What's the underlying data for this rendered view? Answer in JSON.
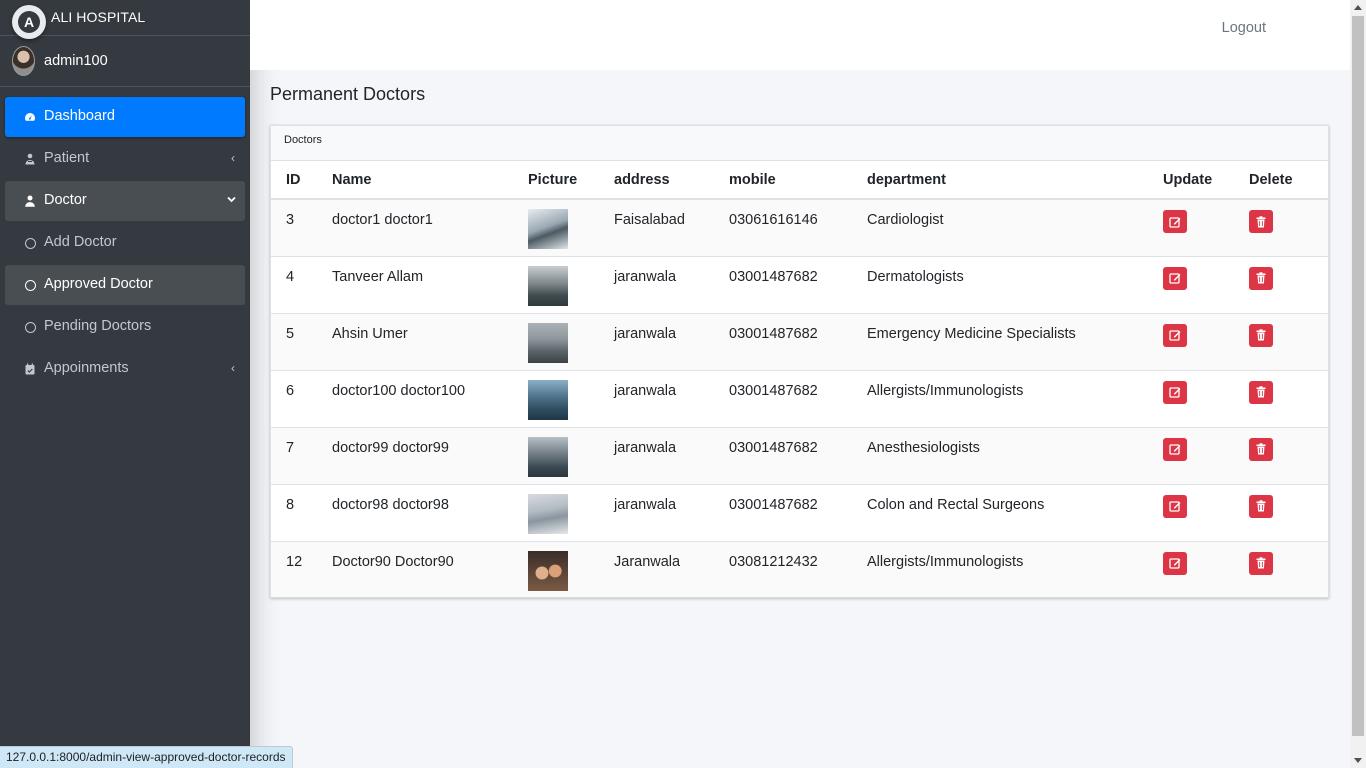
{
  "brand": {
    "name": "ALI HOSPITAL",
    "logo_letter": "A"
  },
  "user": {
    "name": "admin100"
  },
  "sidebar": {
    "items": [
      {
        "label": "Dashboard",
        "icon": "tachometer-icon"
      },
      {
        "label": "Patient",
        "icon": "user-injured-icon"
      },
      {
        "label": "Doctor",
        "icon": "user-icon"
      },
      {
        "label": "Add Doctor",
        "icon": "circle-icon"
      },
      {
        "label": "Approved Doctor",
        "icon": "circle-icon"
      },
      {
        "label": "Pending Doctors",
        "icon": "circle-icon"
      },
      {
        "label": "Appoinments",
        "icon": "calendar-icon"
      }
    ]
  },
  "header": {
    "logout": "Logout"
  },
  "page": {
    "title": "Permanent Doctors"
  },
  "card": {
    "title": "Doctors"
  },
  "table": {
    "columns": [
      "ID",
      "Name",
      "Picture",
      "address",
      "mobile",
      "department",
      "Update",
      "Delete"
    ],
    "rows": [
      {
        "id": "3",
        "name": "doctor1 doctor1",
        "address": "Faisalabad",
        "mobile": "03061616146",
        "department": "Cardiologist"
      },
      {
        "id": "4",
        "name": "Tanveer Allam",
        "address": "jaranwala",
        "mobile": "03001487682",
        "department": "Dermatologists"
      },
      {
        "id": "5",
        "name": "Ahsin Umer",
        "address": "jaranwala",
        "mobile": "03001487682",
        "department": "Emergency Medicine Specialists"
      },
      {
        "id": "6",
        "name": "doctor100 doctor100",
        "address": "jaranwala",
        "mobile": "03001487682",
        "department": "Allergists/Immunologists"
      },
      {
        "id": "7",
        "name": "doctor99 doctor99",
        "address": "jaranwala",
        "mobile": "03001487682",
        "department": "Anesthesiologists"
      },
      {
        "id": "8",
        "name": "doctor98 doctor98",
        "address": "jaranwala",
        "mobile": "03001487682",
        "department": "Colon and Rectal Surgeons"
      },
      {
        "id": "12",
        "name": "Doctor90 Doctor90",
        "address": "Jaranwala",
        "mobile": "03081212432",
        "department": "Allergists/Immunologists"
      }
    ]
  },
  "status_bar": {
    "url": "127.0.0.1:8000/admin-view-approved-doctor-records"
  },
  "colors": {
    "accent": "#007bff",
    "danger": "#dc3545",
    "sidebar": "#343a40"
  }
}
